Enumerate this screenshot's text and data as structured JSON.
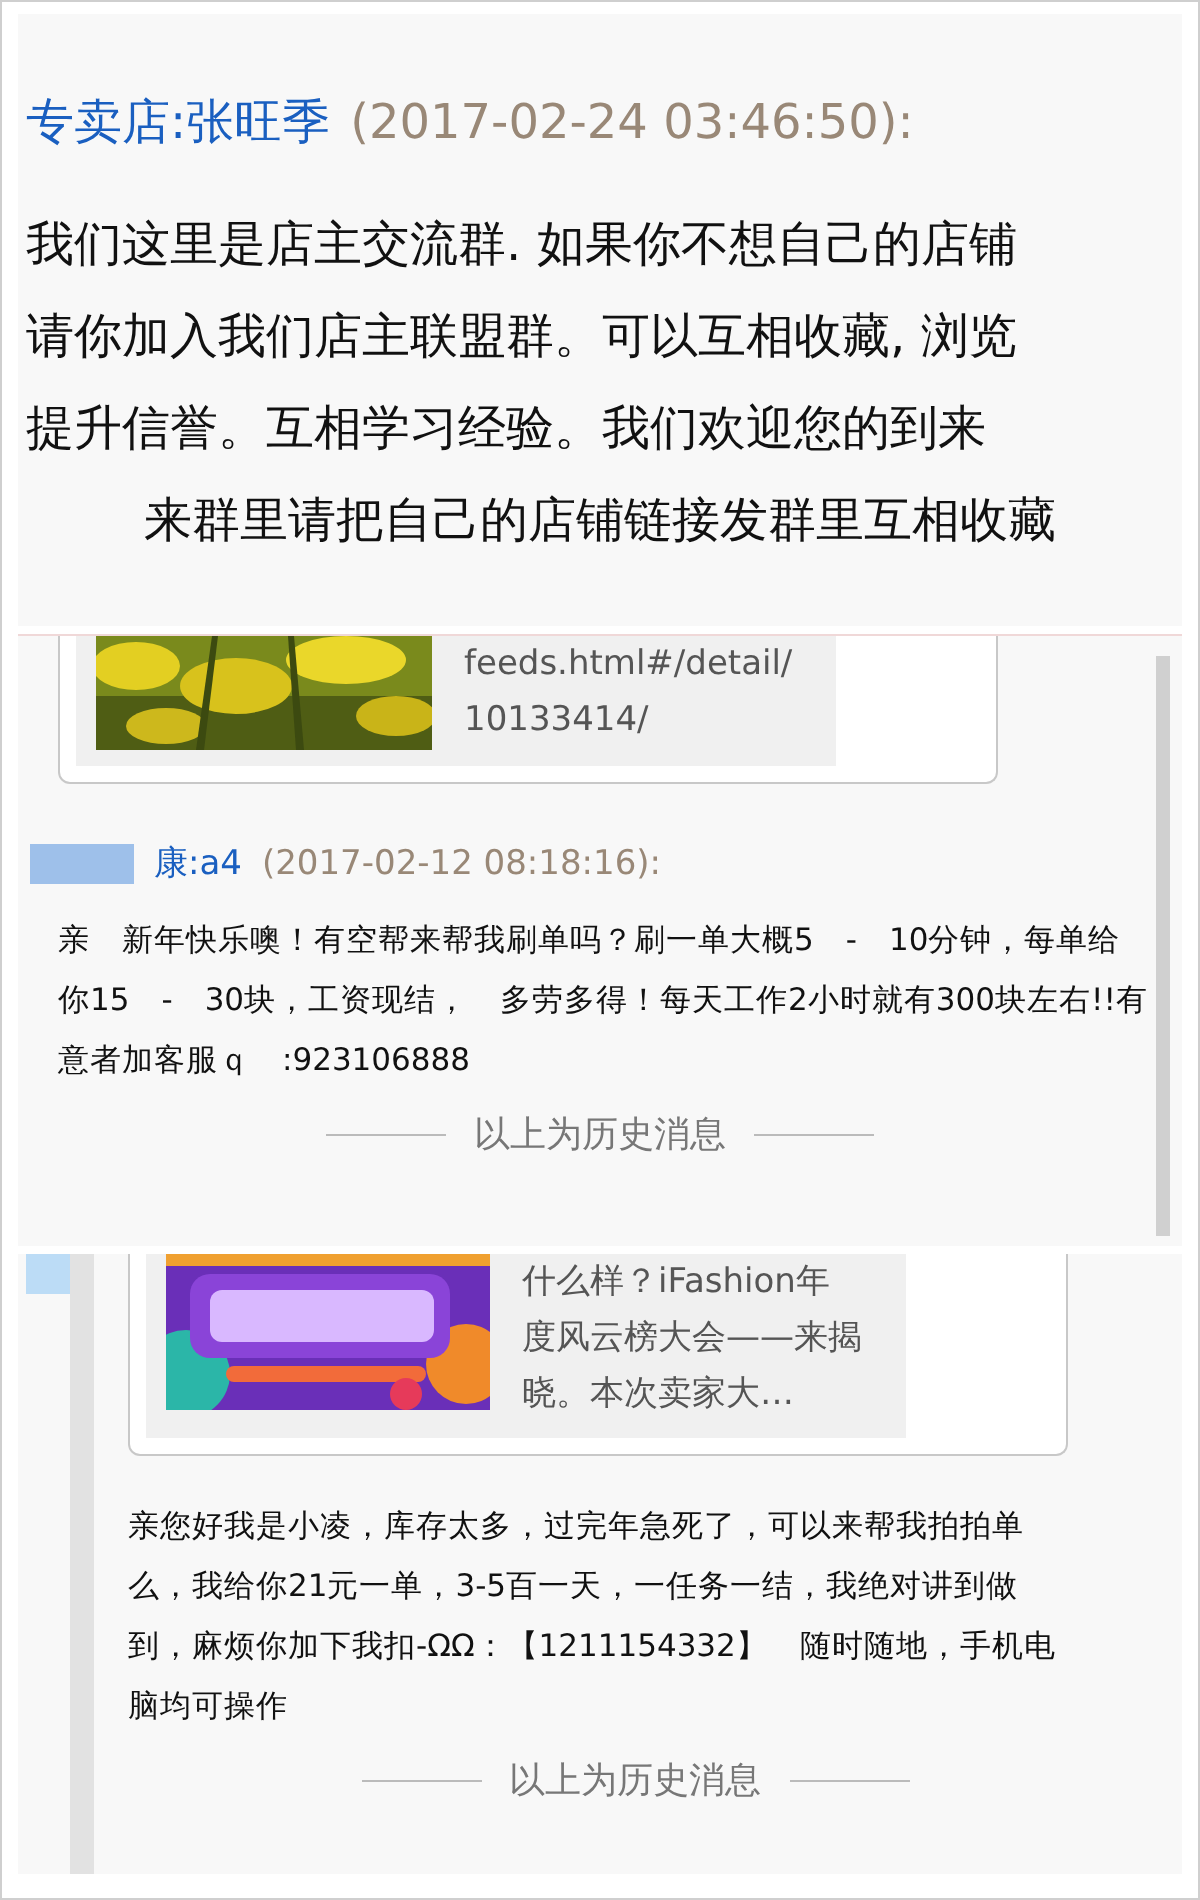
{
  "panels": [
    {
      "kind": "announcement",
      "sender": "专卖店:张旺季",
      "time": "(2017-02-24 03:46:50):",
      "lines": [
        "我们这里是店主交流群. 如果你不想自己的店铺",
        "请你加入我们店主联盟群。可以互相收藏, 浏览",
        "提升信誉。互相学习经验。我们欢迎您的到来",
        "来群里请把自己的店铺链接发群里互相收藏"
      ]
    },
    {
      "kind": "chat",
      "card": {
        "text": "feeds.html#/detail/10133414/"
      },
      "sender": "康:a4",
      "time": "(2017-02-12 08:18:16):",
      "message": "亲　新年快乐噢！有空帮来帮我刷单吗？刷一单大概5　-　10分钟，每单给你15　-　30块，工资现结，　多劳多得！每天工作2小时就有300块左右!!有意者加客服ｑ　:923106888",
      "divider": "以上为历史消息"
    },
    {
      "kind": "chat",
      "card": {
        "text": "什么样？iFashion年度风云榜大会——来揭晓。本次卖家大…"
      },
      "message": "亲您好我是小凌，库存太多，过完年急死了，可以来帮我拍拍单么，我给你21元一单，3-5百一天，一任务一结，我绝对讲到做到，麻烦你加下我扣-ΩΩ：【1211154332】　随时随地，手机电脑均可操作",
      "divider": "以上为历史消息"
    }
  ]
}
